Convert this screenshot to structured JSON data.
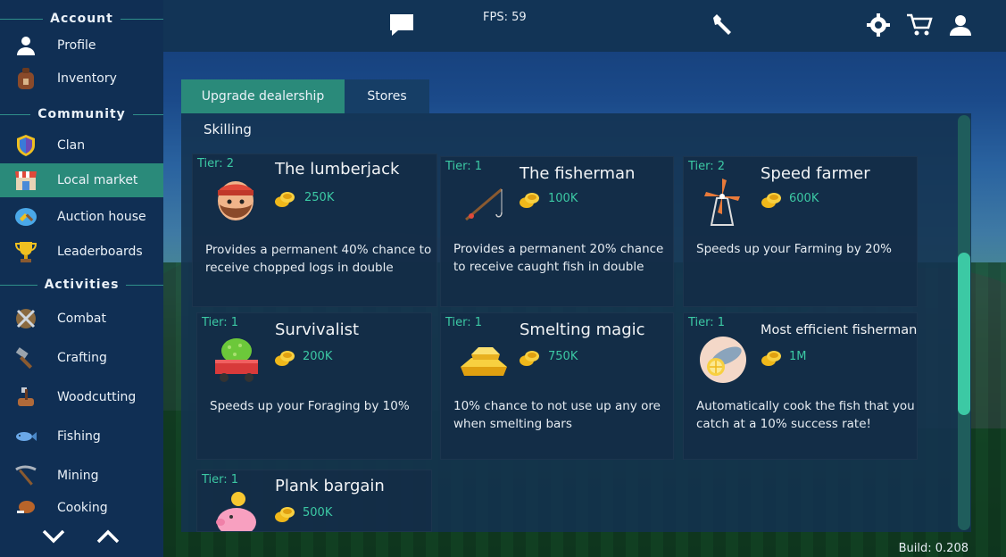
{
  "topbar": {
    "fps": "FPS: 59"
  },
  "sidebar": {
    "sections": [
      {
        "title": "Account",
        "items": [
          {
            "label": "Profile",
            "icon": "person-icon"
          },
          {
            "label": "Inventory",
            "icon": "backpack-icon"
          }
        ]
      },
      {
        "title": "Community",
        "items": [
          {
            "label": "Clan",
            "icon": "shield-icon"
          },
          {
            "label": "Local market",
            "icon": "market-stall-icon"
          },
          {
            "label": "Auction house",
            "icon": "auction-icon"
          },
          {
            "label": "Leaderboards",
            "icon": "trophy-icon"
          }
        ]
      },
      {
        "title": "Activities",
        "items": [
          {
            "label": "Combat",
            "icon": "crossed-swords-icon"
          },
          {
            "label": "Crafting",
            "icon": "hammer-icon"
          },
          {
            "label": "Woodcutting",
            "icon": "axe-log-icon"
          },
          {
            "label": "Fishing",
            "icon": "fish-icon"
          },
          {
            "label": "Mining",
            "icon": "pickaxe-icon"
          },
          {
            "label": "Cooking",
            "icon": "chicken-leg-icon"
          }
        ]
      }
    ],
    "active": "Local market"
  },
  "tabs": [
    {
      "label": "Upgrade dealership",
      "active": true
    },
    {
      "label": "Stores",
      "active": false
    }
  ],
  "panel": {
    "section_title": "Skilling",
    "cards": [
      {
        "tier": "Tier: 2",
        "name": "The lumberjack",
        "price": "250K",
        "desc": "Provides a permanent 40% chance to receive chopped logs in double",
        "icon": "lumberjack-icon"
      },
      {
        "tier": "Tier: 1",
        "name": "The fisherman",
        "price": "100K",
        "desc": "Provides a permanent 20% chance to receive caught fish in double",
        "icon": "fishing-rod-icon"
      },
      {
        "tier": "Tier: 2",
        "name": "Speed farmer",
        "price": "600K",
        "desc": "Speeds up your Farming by 20%",
        "icon": "windmill-icon"
      },
      {
        "tier": "Tier: 1",
        "name": "Survivalist",
        "price": "200K",
        "desc": "Speeds up your Foraging by 10%",
        "icon": "berry-cart-icon"
      },
      {
        "tier": "Tier: 1",
        "name": "Smelting magic",
        "price": "750K",
        "desc": "10% chance to not use up any ore when smelting bars",
        "icon": "gold-bars-icon"
      },
      {
        "tier": "Tier: 1",
        "name": "Most efficient fisherman",
        "price": "1M",
        "desc": "Automatically cook the fish that you catch at a 10% success rate!",
        "icon": "cooked-fish-icon"
      },
      {
        "tier": "Tier: 1",
        "name": "Plank bargain",
        "price": "500K",
        "desc": "",
        "icon": "piggy-bank-icon"
      }
    ]
  },
  "footer": {
    "build": "Build: 0.208"
  },
  "colors": {
    "accent": "#2a8a7a",
    "highlight": "#3cc9a4",
    "sidebar": "#102f54",
    "topbar": "#123456"
  }
}
